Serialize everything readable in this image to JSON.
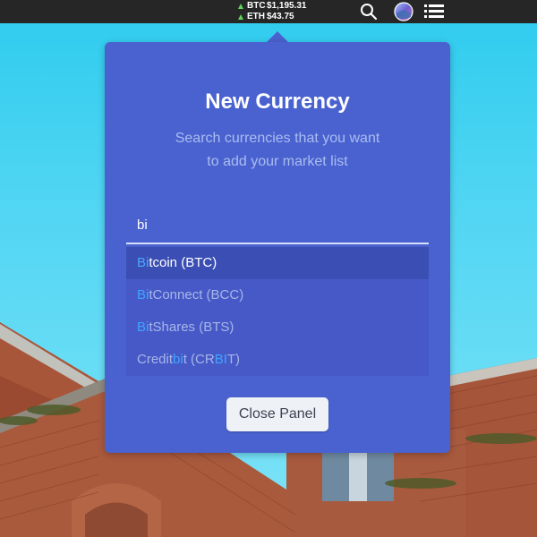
{
  "menubar": {
    "tickers": [
      {
        "symbol": "BTC",
        "price": "$1,195.31",
        "trend": "up"
      },
      {
        "symbol": "ETH",
        "price": "$43.75",
        "trend": "up"
      }
    ],
    "icons": [
      "search-icon",
      "avatar-icon",
      "list-menu-icon"
    ]
  },
  "panel": {
    "title": "New Currency",
    "subtitle_line1": "Search currencies that you want",
    "subtitle_line2": "to add your market list",
    "search_value": "bi",
    "results": [
      {
        "parts": [
          {
            "text": "Bi",
            "hl": true
          },
          {
            "text": "tcoin (BTC)",
            "hl": false
          }
        ],
        "selected": true
      },
      {
        "parts": [
          {
            "text": "Bi",
            "hl": true
          },
          {
            "text": "tConnect (BCC)",
            "hl": false
          }
        ],
        "selected": false
      },
      {
        "parts": [
          {
            "text": "Bi",
            "hl": true
          },
          {
            "text": "tShares (BTS)",
            "hl": false
          }
        ],
        "selected": false
      },
      {
        "parts": [
          {
            "text": "Credit",
            "hl": false
          },
          {
            "text": "bi",
            "hl": true
          },
          {
            "text": "t (CR",
            "hl": false
          },
          {
            "text": "BI",
            "hl": true
          },
          {
            "text": "T)",
            "hl": false
          }
        ],
        "selected": false
      }
    ],
    "close_label": "Close Panel"
  },
  "colors": {
    "panel": "#4a62cf",
    "highlight": "#3fa5ff",
    "trend_up": "#5ed45e"
  }
}
